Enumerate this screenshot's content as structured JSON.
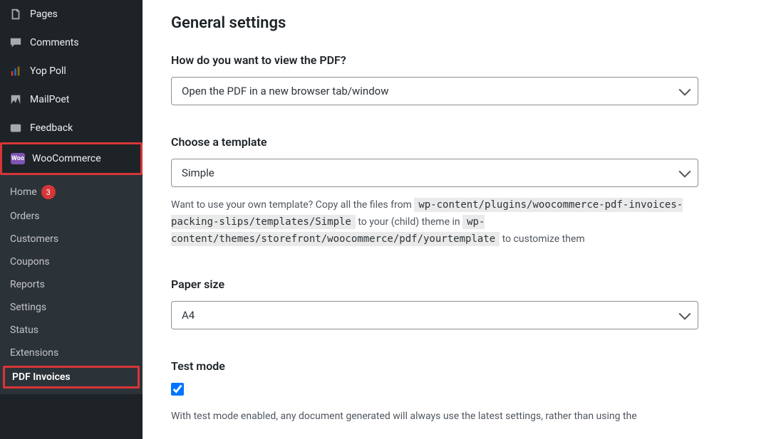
{
  "sidebar": {
    "pages_label": "Pages",
    "comments_label": "Comments",
    "yoppoll_label": "Yop Poll",
    "mailpoet_label": "MailPoet",
    "feedback_label": "Feedback",
    "woocommerce_label": "WooCommerce",
    "submenu": {
      "home_label": "Home",
      "home_badge": "3",
      "orders_label": "Orders",
      "customers_label": "Customers",
      "coupons_label": "Coupons",
      "reports_label": "Reports",
      "settings_label": "Settings",
      "status_label": "Status",
      "extensions_label": "Extensions",
      "pdfinvoices_label": "PDF Invoices"
    }
  },
  "content": {
    "section_title": "General settings",
    "view_pdf_label": "How do you want to view the PDF?",
    "view_pdf_value": "Open the PDF in a new browser tab/window",
    "template_label": "Choose a template",
    "template_value": "Simple",
    "template_help_prefix": "Want to use your own template? Copy all the files from ",
    "template_code1": "wp-content/plugins/woocommerce-pdf-invoices-packing-slips/templates/Simple",
    "template_help_mid": " to your (child) theme in ",
    "template_code2": "wp-content/themes/storefront/woocommerce/pdf/yourtemplate",
    "template_help_suffix": " to customize them",
    "paper_label": "Paper size",
    "paper_value": "A4",
    "test_label": "Test mode",
    "test_checked": true,
    "test_help": "With test mode enabled, any document generated will always use the latest settings, rather than using the"
  }
}
